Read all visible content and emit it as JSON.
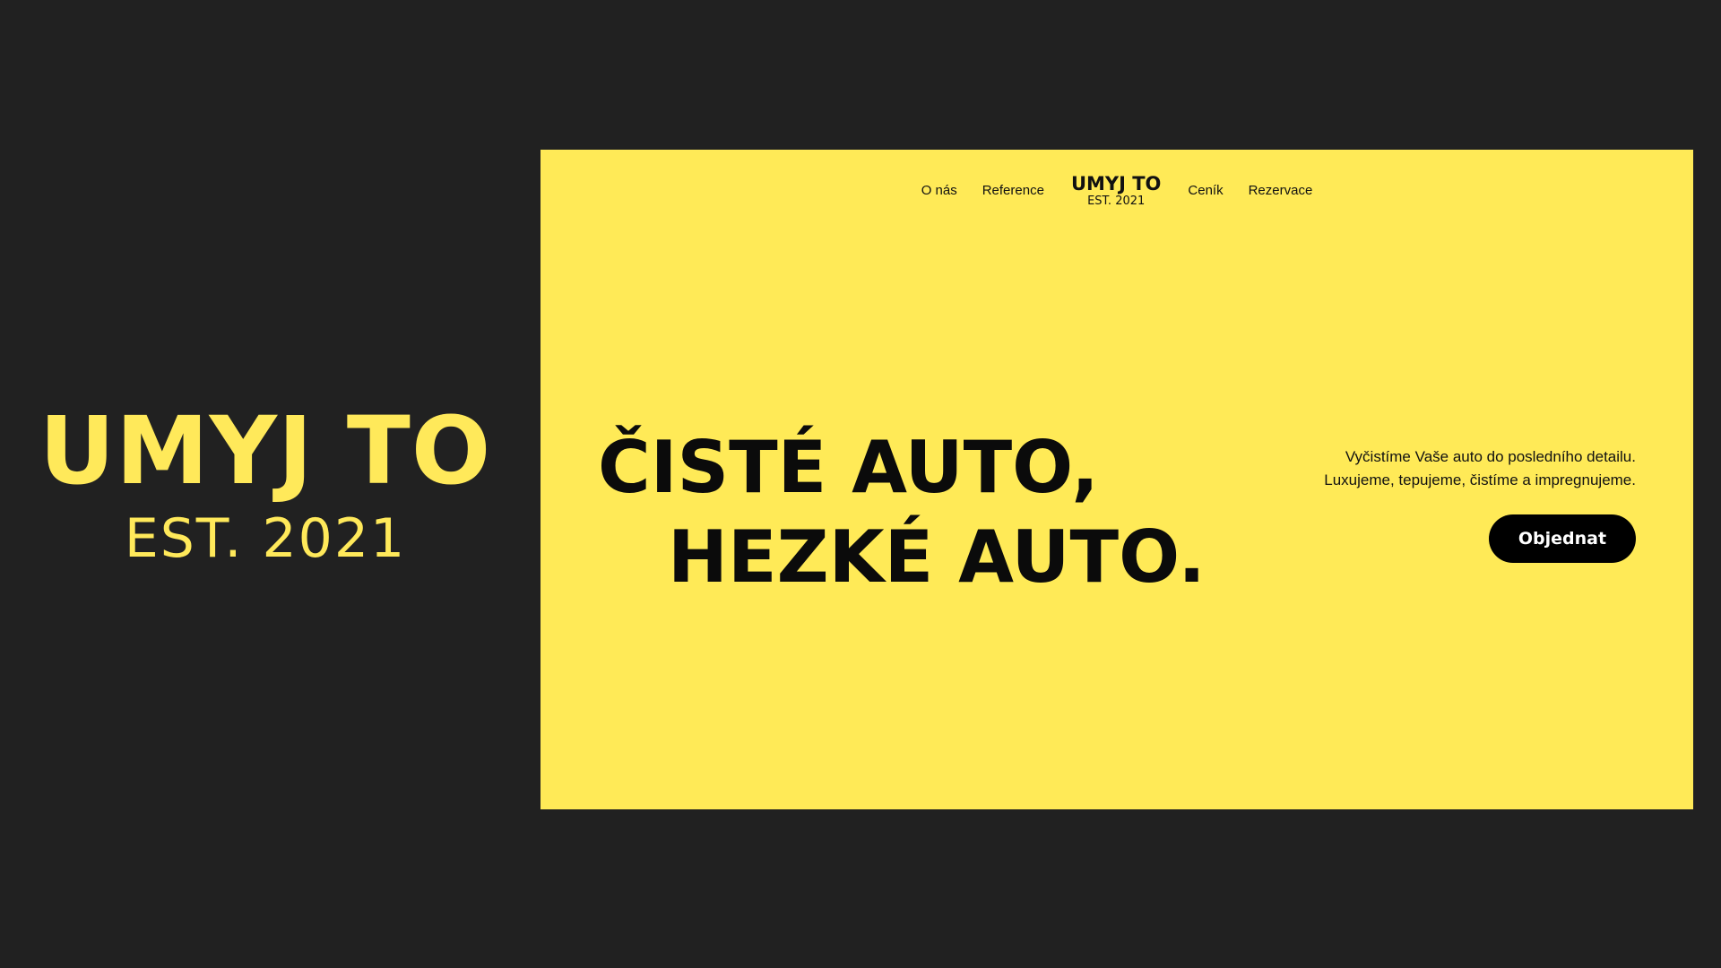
{
  "brand": {
    "name": "UMYJ TO",
    "est": "EST. 2021"
  },
  "site": {
    "nav": {
      "left": [
        "O nás",
        "Reference"
      ],
      "logo_name": "UMYJ TO",
      "logo_est": "EST. 2021",
      "right": [
        "Ceník",
        "Rezervace"
      ]
    },
    "hero": {
      "line1": "ČISTÉ AUTO,",
      "line2": "HEZKÉ AUTO.",
      "desc1": "Vyčistíme Vaše auto do posledního detailu.",
      "desc2": "Luxujeme, tepujeme, čistíme a impregnujeme.",
      "cta": "Objednat"
    }
  },
  "colors": {
    "background": "#212121",
    "accent": "#ffea57",
    "text": "#111111"
  }
}
